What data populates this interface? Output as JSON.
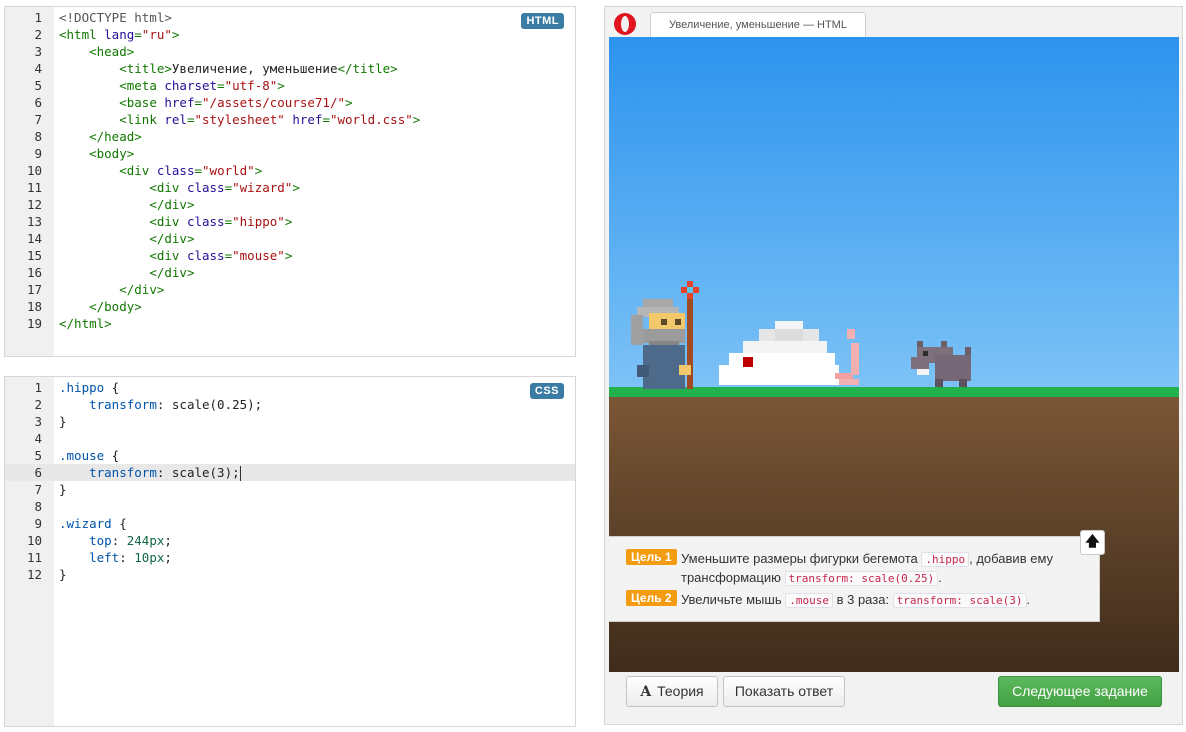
{
  "html_editor": {
    "badge": "HTML",
    "line_numbers": [
      "1",
      "2",
      "3",
      "4",
      "5",
      "6",
      "7",
      "8",
      "9",
      "10",
      "11",
      "12",
      "13",
      "14",
      "15",
      "16",
      "17",
      "18",
      "19"
    ],
    "lines": [
      {
        "indent": "",
        "parts": [
          {
            "cls": "doc",
            "text": "<!DOCTYPE html>"
          }
        ]
      },
      {
        "indent": "",
        "parts": [
          {
            "cls": "t",
            "text": "<html "
          },
          {
            "cls": "a",
            "text": "lang"
          },
          {
            "cls": "t",
            "text": "="
          },
          {
            "cls": "s",
            "text": "\"ru\""
          },
          {
            "cls": "t",
            "text": ">"
          }
        ]
      },
      {
        "indent": "    ",
        "parts": [
          {
            "cls": "t",
            "text": "<head>"
          }
        ]
      },
      {
        "indent": "        ",
        "parts": [
          {
            "cls": "t",
            "text": "<title>"
          },
          {
            "cls": "",
            "text": "Увеличение, уменьшение"
          },
          {
            "cls": "t",
            "text": "</title>"
          }
        ]
      },
      {
        "indent": "        ",
        "parts": [
          {
            "cls": "t",
            "text": "<meta "
          },
          {
            "cls": "a",
            "text": "charset"
          },
          {
            "cls": "t",
            "text": "="
          },
          {
            "cls": "s",
            "text": "\"utf-8\""
          },
          {
            "cls": "t",
            "text": ">"
          }
        ]
      },
      {
        "indent": "        ",
        "parts": [
          {
            "cls": "t",
            "text": "<base "
          },
          {
            "cls": "a",
            "text": "href"
          },
          {
            "cls": "t",
            "text": "="
          },
          {
            "cls": "s",
            "text": "\"/assets/course71/\""
          },
          {
            "cls": "t",
            "text": ">"
          }
        ]
      },
      {
        "indent": "        ",
        "parts": [
          {
            "cls": "t",
            "text": "<link "
          },
          {
            "cls": "a",
            "text": "rel"
          },
          {
            "cls": "t",
            "text": "="
          },
          {
            "cls": "s",
            "text": "\"stylesheet\""
          },
          {
            "cls": "a",
            "text": " href"
          },
          {
            "cls": "t",
            "text": "="
          },
          {
            "cls": "s",
            "text": "\"world.css\""
          },
          {
            "cls": "t",
            "text": ">"
          }
        ]
      },
      {
        "indent": "    ",
        "parts": [
          {
            "cls": "t",
            "text": "</head>"
          }
        ]
      },
      {
        "indent": "    ",
        "parts": [
          {
            "cls": "t",
            "text": "<body>"
          }
        ]
      },
      {
        "indent": "        ",
        "parts": [
          {
            "cls": "t",
            "text": "<div "
          },
          {
            "cls": "a",
            "text": "class"
          },
          {
            "cls": "t",
            "text": "="
          },
          {
            "cls": "s",
            "text": "\"world\""
          },
          {
            "cls": "t",
            "text": ">"
          }
        ]
      },
      {
        "indent": "            ",
        "parts": [
          {
            "cls": "t",
            "text": "<div "
          },
          {
            "cls": "a",
            "text": "class"
          },
          {
            "cls": "t",
            "text": "="
          },
          {
            "cls": "s",
            "text": "\"wizard\""
          },
          {
            "cls": "t",
            "text": ">"
          }
        ]
      },
      {
        "indent": "            ",
        "parts": [
          {
            "cls": "t",
            "text": "</div>"
          }
        ]
      },
      {
        "indent": "            ",
        "parts": [
          {
            "cls": "t",
            "text": "<div "
          },
          {
            "cls": "a",
            "text": "class"
          },
          {
            "cls": "t",
            "text": "="
          },
          {
            "cls": "s",
            "text": "\"hippo\""
          },
          {
            "cls": "t",
            "text": ">"
          }
        ]
      },
      {
        "indent": "            ",
        "parts": [
          {
            "cls": "t",
            "text": "</div>"
          }
        ]
      },
      {
        "indent": "            ",
        "parts": [
          {
            "cls": "t",
            "text": "<div "
          },
          {
            "cls": "a",
            "text": "class"
          },
          {
            "cls": "t",
            "text": "="
          },
          {
            "cls": "s",
            "text": "\"mouse\""
          },
          {
            "cls": "t",
            "text": ">"
          }
        ]
      },
      {
        "indent": "            ",
        "parts": [
          {
            "cls": "t",
            "text": "</div>"
          }
        ]
      },
      {
        "indent": "        ",
        "parts": [
          {
            "cls": "t",
            "text": "</div>"
          }
        ]
      },
      {
        "indent": "    ",
        "parts": [
          {
            "cls": "t",
            "text": "</body>"
          }
        ]
      },
      {
        "indent": "",
        "parts": [
          {
            "cls": "t",
            "text": "</html>"
          }
        ]
      }
    ]
  },
  "css_editor": {
    "badge": "CSS",
    "active_line": 6,
    "line_numbers": [
      "1",
      "2",
      "3",
      "4",
      "5",
      "6",
      "7",
      "8",
      "9",
      "10",
      "11",
      "12"
    ],
    "lines": [
      {
        "indent": "",
        "parts": [
          {
            "cls": "sel",
            "text": ".hippo"
          },
          {
            "cls": "brace",
            "text": " {"
          }
        ]
      },
      {
        "indent": "    ",
        "parts": [
          {
            "cls": "prop",
            "text": "transform"
          },
          {
            "cls": "brace",
            "text": ": scale(0.25);"
          }
        ]
      },
      {
        "indent": "",
        "parts": [
          {
            "cls": "brace",
            "text": "}"
          }
        ]
      },
      {
        "indent": "",
        "parts": []
      },
      {
        "indent": "",
        "parts": [
          {
            "cls": "sel",
            "text": ".mouse"
          },
          {
            "cls": "brace",
            "text": " {"
          }
        ]
      },
      {
        "indent": "    ",
        "parts": [
          {
            "cls": "prop",
            "text": "transform"
          },
          {
            "cls": "brace",
            "text": ": scale(3);"
          }
        ]
      },
      {
        "indent": "",
        "parts": [
          {
            "cls": "brace",
            "text": "}"
          }
        ]
      },
      {
        "indent": "",
        "parts": []
      },
      {
        "indent": "",
        "parts": [
          {
            "cls": "sel",
            "text": ".wizard"
          },
          {
            "cls": "brace",
            "text": " {"
          }
        ]
      },
      {
        "indent": "    ",
        "parts": [
          {
            "cls": "prop",
            "text": "top"
          },
          {
            "cls": "brace",
            "text": ": "
          },
          {
            "cls": "num",
            "text": "244px"
          },
          {
            "cls": "brace",
            "text": ";"
          }
        ]
      },
      {
        "indent": "    ",
        "parts": [
          {
            "cls": "prop",
            "text": "left"
          },
          {
            "cls": "brace",
            "text": ": "
          },
          {
            "cls": "num",
            "text": "10px"
          },
          {
            "cls": "brace",
            "text": ";"
          }
        ]
      },
      {
        "indent": "",
        "parts": [
          {
            "cls": "brace",
            "text": "}"
          }
        ]
      }
    ]
  },
  "browser": {
    "logo_icon": "opera-logo-icon",
    "tab_title": "Увеличение, уменьшение — HTML"
  },
  "colors": {
    "sky_top": "#2c93ee",
    "sky_bottom": "#7cc2f6",
    "grass": "#22b14c",
    "ground_top": "#7a5636",
    "ground_bottom": "#3f2c1b",
    "task_label": "#f39c12",
    "next_button": "#5cb85c"
  },
  "tasks": [
    {
      "label": "Цель 1",
      "text_before": "Уменьшите размеры фигурки бегемота ",
      "code_1": ".hippo",
      "text_middle": ", добавив ему трансформацию ",
      "code_2": "transform: scale(0.25)",
      "text_after": "."
    },
    {
      "label": "Цель 2",
      "text_before": "Увеличьте мышь ",
      "code_1": ".mouse",
      "text_middle": " в 3 раза: ",
      "code_2": "transform: scale(3)",
      "text_after": "."
    }
  ],
  "collapse_button": {
    "icon": "arrow-up-icon",
    "glyph": "🡅"
  },
  "buttons": {
    "theory_glyph": "A",
    "theory": "Теория",
    "show_answer": "Показать ответ",
    "next_task": "Следующее задание"
  }
}
